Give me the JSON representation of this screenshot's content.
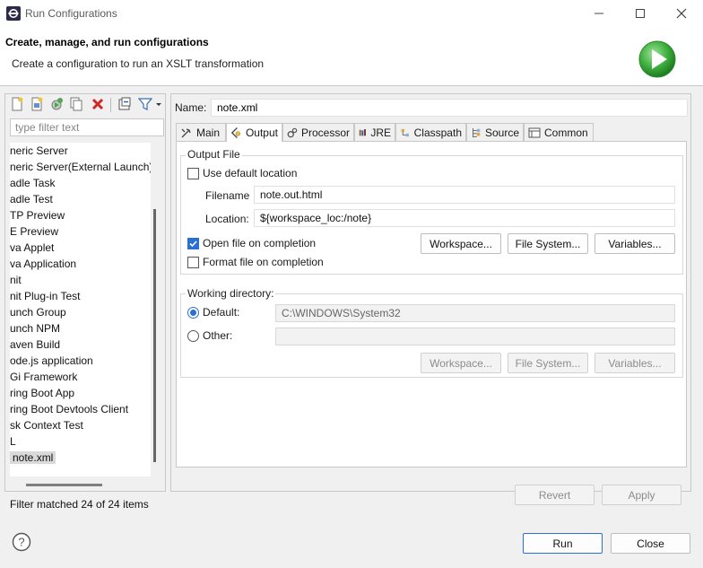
{
  "window": {
    "title": "Run Configurations"
  },
  "header": {
    "title": "Create, manage, and run configurations",
    "description": "Create a configuration to run an XSLT transformation"
  },
  "left": {
    "filter_placeholder": "type filter text",
    "items": [
      "neric Server",
      "neric Server(External Launch)",
      "adle Task",
      "adle Test",
      "TP Preview",
      "E Preview",
      "va Applet",
      "va Application",
      "nit",
      "nit Plug-in Test",
      "unch Group",
      "unch NPM",
      "aven Build",
      "ode.js application",
      "Gi Framework",
      "ring Boot App",
      "ring Boot Devtools Client",
      "sk Context Test",
      "L",
      "note.xml"
    ],
    "filter_status": "Filter matched 24 of 24 items"
  },
  "config": {
    "name_label": "Name:",
    "name_value": "note.xml",
    "tabs": [
      "Main",
      "Output",
      "Processor",
      "JRE",
      "Classpath",
      "Source",
      "Common"
    ],
    "active_tab": "Output"
  },
  "output_file": {
    "group_title": "Output File",
    "use_default_label": "Use default location",
    "use_default_checked": false,
    "filename_label": "Filename",
    "filename_value": "note.out.html",
    "location_label": "Location:",
    "location_value": "${workspace_loc:/note}",
    "open_on_completion_label": "Open file on completion",
    "open_on_completion_checked": true,
    "format_on_completion_label": "Format file on completion",
    "format_on_completion_checked": false,
    "workspace_btn": "Workspace...",
    "filesystem_btn": "File System...",
    "variables_btn": "Variables..."
  },
  "working_dir": {
    "group_title": "Working directory:",
    "default_label": "Default:",
    "default_value": "C:\\WINDOWS\\System32",
    "other_label": "Other:",
    "other_value": "",
    "workspace_btn": "Workspace...",
    "filesystem_btn": "File System...",
    "variables_btn": "Variables..."
  },
  "footer": {
    "revert_label": "Revert",
    "apply_label": "Apply",
    "run_label": "Run",
    "close_label": "Close"
  },
  "colors": {
    "accent": "#2a6fd6",
    "run_green": "#3cae3c"
  }
}
